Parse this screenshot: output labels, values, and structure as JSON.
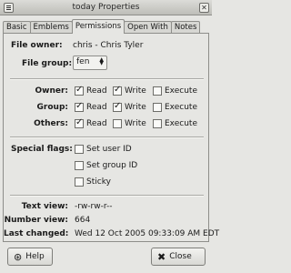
{
  "window": {
    "title": "today Properties"
  },
  "tabs": [
    {
      "label": "Basic"
    },
    {
      "label": "Emblems"
    },
    {
      "label": "Permissions",
      "active": true
    },
    {
      "label": "Open With"
    },
    {
      "label": "Notes"
    }
  ],
  "owner": {
    "label": "File owner:",
    "value": "chris - Chris Tyler"
  },
  "group": {
    "label": "File group:",
    "value": "fen"
  },
  "permissions": {
    "rows": [
      {
        "label": "Owner:",
        "read": true,
        "write": true,
        "execute": false
      },
      {
        "label": "Group:",
        "read": true,
        "write": true,
        "execute": false
      },
      {
        "label": "Others:",
        "read": true,
        "write": false,
        "execute": false
      }
    ],
    "read_label": "Read",
    "write_label": "Write",
    "execute_label": "Execute"
  },
  "special": {
    "label": "Special flags:",
    "set_user_id": "Set user ID",
    "set_group_id": "Set group ID",
    "sticky": "Sticky"
  },
  "info": {
    "text_view_label": "Text view:",
    "text_view": "-rw-rw-r--",
    "number_view_label": "Number view:",
    "number_view": "664",
    "last_changed_label": "Last changed:",
    "last_changed": "Wed 12 Oct 2005 09:33:09 AM EDT"
  },
  "buttons": {
    "help": "Help",
    "close": "Close"
  }
}
